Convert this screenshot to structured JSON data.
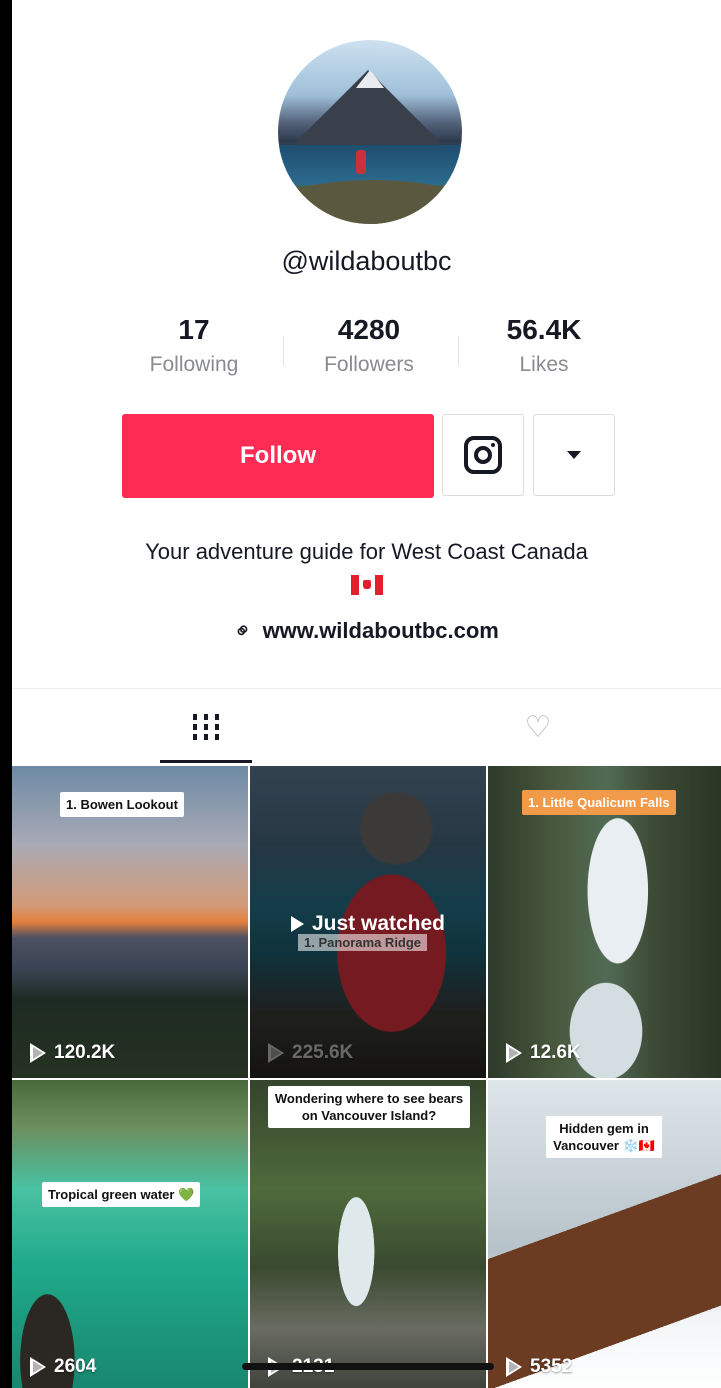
{
  "profile": {
    "username": "@wildaboutbc",
    "following_count": "17",
    "following_label": "Following",
    "followers_count": "4280",
    "followers_label": "Followers",
    "likes_count": "56.4K",
    "likes_label": "Likes",
    "follow_label": "Follow",
    "bio": "Your adventure guide for West Coast Canada",
    "link": "www.wildaboutbc.com"
  },
  "icons": {
    "instagram": "instagram-icon",
    "more": "caret-down-icon",
    "link": "link-icon",
    "videos_tab": "grid-icon",
    "liked_tab": "hidden-heart-icon"
  },
  "colors": {
    "accent": "#fe2c55",
    "text": "#161823",
    "muted": "#8a8b91"
  },
  "videos": [
    {
      "label": "1. Bowen Lookout",
      "views": "120.2K"
    },
    {
      "label": "1. Panorama Ridge",
      "overlay": "Just watched",
      "views": "225.6K"
    },
    {
      "label": "1. Little Qualicum Falls",
      "views": "12.6K"
    },
    {
      "label": "Tropical green water 💚",
      "views": "2604"
    },
    {
      "label": "Wondering where to see bears on Vancouver Island?",
      "views": "2131"
    },
    {
      "label": "Hidden gem in Vancouver ❄️🇨🇦",
      "views": "5352"
    }
  ]
}
